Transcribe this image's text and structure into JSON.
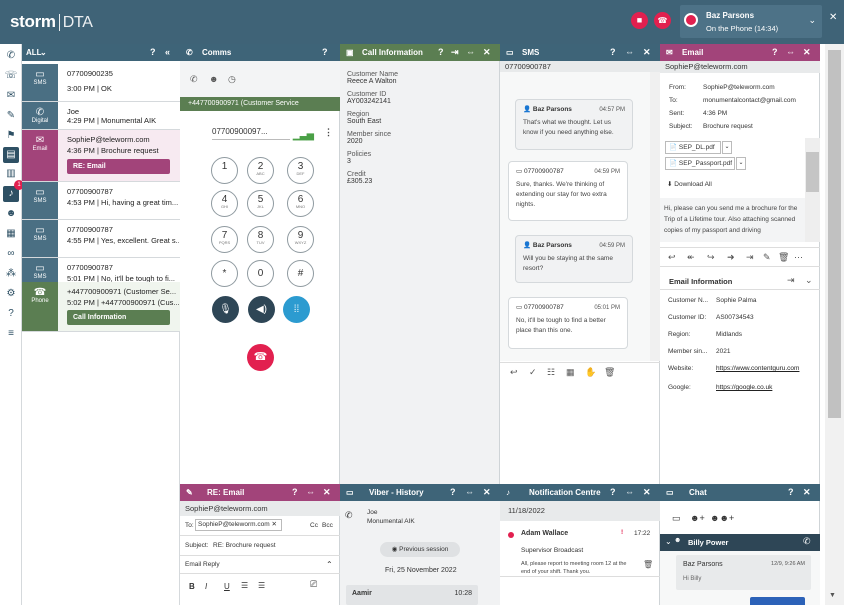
{
  "topbar": {
    "logo_main": "storm",
    "logo_sub": "DTA",
    "agent_name": "Baz Parsons",
    "agent_status": "On the Phone  (14:34)"
  },
  "queue": {
    "filter": "ALL",
    "items": [
      {
        "type": "SMS",
        "l1": "07700900235",
        "l2": "3:00 PM | OK"
      },
      {
        "type": "Digital",
        "l1": "Joe",
        "l2": "4:29 PM | Monumental AIK"
      },
      {
        "type": "Email",
        "l1": "SophieP@teleworm.com",
        "l2": "4:36 PM | Brochure request",
        "button": "RE: Email"
      },
      {
        "type": "SMS",
        "l1": "07700900787",
        "l2": "4:53 PM | Hi, having a great tim..."
      },
      {
        "type": "SMS",
        "l1": "07700900787",
        "l2": "4:55 PM | Yes, excellent. Great s..."
      },
      {
        "type": "SMS",
        "l1": "07700900787",
        "l2": "5:01 PM | No, it'll be tough to fi..."
      },
      {
        "type": "Phone",
        "l1": "+447700900971 (Customer Se...",
        "l2": "5:02 PM | +447700900971 (Cus...",
        "button": "Call Information"
      }
    ]
  },
  "comms": {
    "title": "Comms",
    "active_call": "+447700900971 (Customer Service",
    "dial_number": "07700900097...",
    "keys": [
      {
        "d": "1",
        "s": ""
      },
      {
        "d": "2",
        "s": "ABC"
      },
      {
        "d": "3",
        "s": "DEF"
      },
      {
        "d": "4",
        "s": "GHI"
      },
      {
        "d": "5",
        "s": "JKL"
      },
      {
        "d": "6",
        "s": "MNO"
      },
      {
        "d": "7",
        "s": "PQRS"
      },
      {
        "d": "8",
        "s": "TUV"
      },
      {
        "d": "9",
        "s": "WXYZ"
      },
      {
        "d": "*",
        "s": ""
      },
      {
        "d": "0",
        "s": "+"
      },
      {
        "d": "#",
        "s": ""
      }
    ]
  },
  "callinfo": {
    "title": "Call Information",
    "fields": [
      {
        "label": "Customer Name",
        "value": "Reece A Walton"
      },
      {
        "label": "Customer ID",
        "value": "AY003242141"
      },
      {
        "label": "Region",
        "value": "South East"
      },
      {
        "label": "Member since",
        "value": "2020"
      },
      {
        "label": "Policies",
        "value": "3"
      },
      {
        "label": "Credit",
        "value": "£305.23"
      }
    ]
  },
  "sms": {
    "title": "SMS",
    "number": "07700900787",
    "messages": [
      {
        "from": "Baz Parsons",
        "time": "04:57 PM",
        "text": "That's what we thought. Let us know if you need anything else."
      },
      {
        "from": "07700900787",
        "time": "04:59 PM",
        "text": "Sure, thanks. We're thinking of extending our stay for two extra nights."
      },
      {
        "from": "Baz Parsons",
        "time": "04:59 PM",
        "text": "Will you be staying at the same resort?"
      },
      {
        "from": "07700900787",
        "time": "05:01 PM",
        "text": "No, it'll be tough to find a better place than this one."
      }
    ]
  },
  "email": {
    "title": "Email",
    "address": "SophieP@teleworm.com",
    "from_label": "From:",
    "from": "SophieP@teleworm.com",
    "to_label": "To:",
    "to": "monumentalcontact@gmail.com",
    "sent_label": "Sent:",
    "sent": "4:36 PM",
    "subject_label": "Subject:",
    "subject": "Brochure request",
    "attachments": [
      "SEP_DL.pdf",
      "SEP_Passport.pdf"
    ],
    "download": "Download All",
    "body": "Hi, please can you send me a brochure for the Trip of a Lifetime tour. Also attaching scanned copies of my passport and driving",
    "info_title": "Email Information",
    "info": [
      {
        "label": "Customer N...",
        "value": "Sophie Palma",
        "link": false
      },
      {
        "label": "Customer ID:",
        "value": "AS00734543",
        "link": false
      },
      {
        "label": "Region:",
        "value": "Midlands",
        "link": false
      },
      {
        "label": "Member sin...",
        "value": "2021",
        "link": false
      },
      {
        "label": "Website:",
        "value": "https://www.contentguru.com",
        "link": true
      },
      {
        "label": "Google:",
        "value": "https://google.co.uk",
        "link": true
      }
    ]
  },
  "reemail": {
    "title": "RE: Email",
    "address": "SophieP@teleworm.com",
    "to_label": "To:",
    "to_chip": "SophieP@teleworm.com",
    "cc": "Cc",
    "bcc": "Bcc",
    "subject_label": "Subject:",
    "subject": "RE: Brochure request",
    "reply_type": "Email Reply"
  },
  "viber": {
    "title": "Viber - History",
    "name": "Joe",
    "sub": "Monumental AIK",
    "prev": "Previous session",
    "date": "Fri, 25 November 2022",
    "msg_from": "Aamir",
    "msg_time": "10:28"
  },
  "notif": {
    "title": "Notification Centre",
    "date": "11/18/2022",
    "from": "Adam Wallace",
    "time": "17:22",
    "kind": "Supervisor Broadcast",
    "text": "All, please report to meeting room 12 at the end of your shift. Thank you."
  },
  "chat": {
    "title": "Chat",
    "contact": "Billy Power",
    "msg_from": "Baz Parsons",
    "msg_time": "12/9, 9:26 AM",
    "msg_text": "Hi Billy"
  }
}
